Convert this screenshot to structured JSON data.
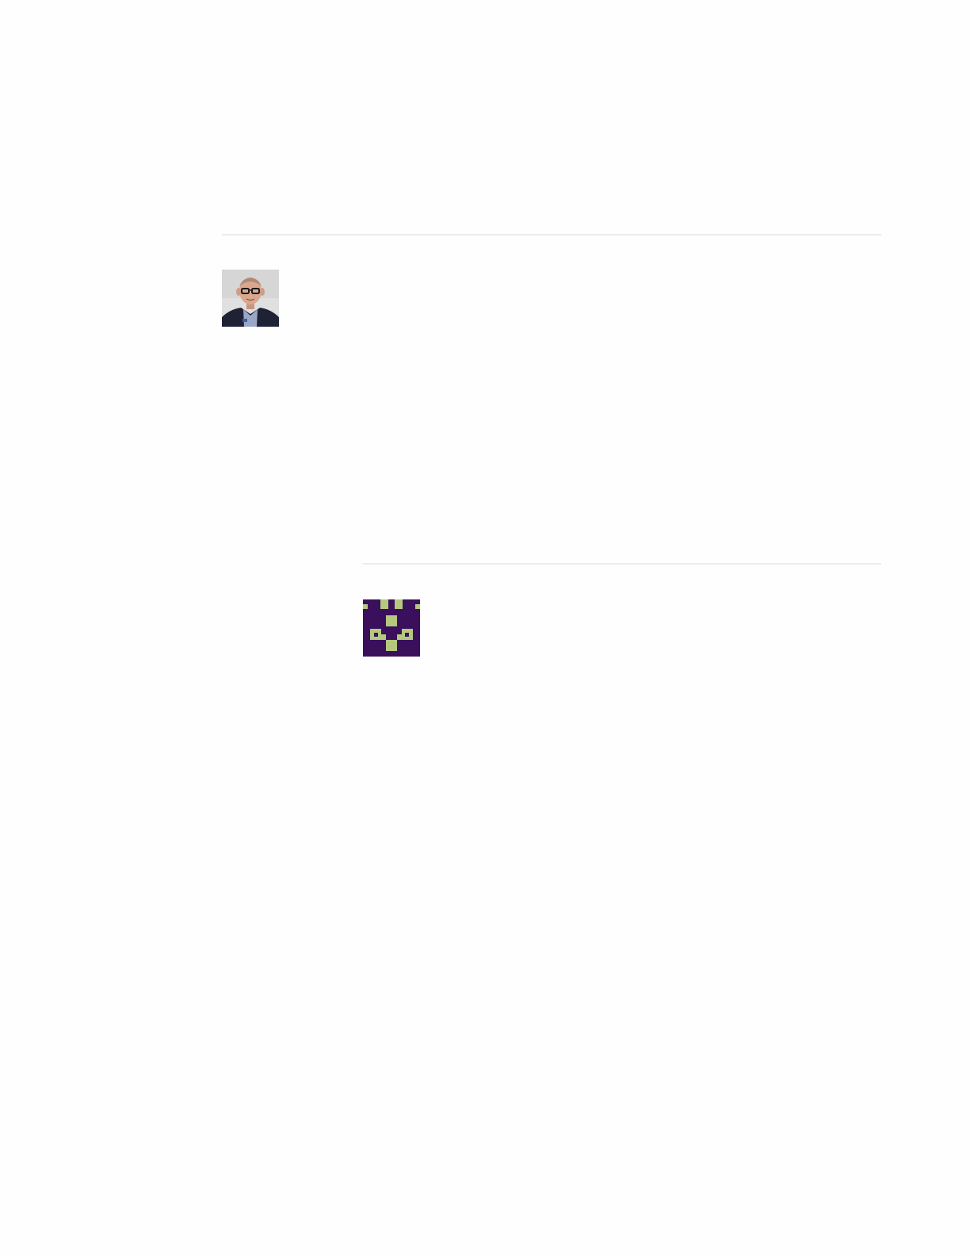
{
  "comments": [
    {
      "avatar": {
        "kind": "photo",
        "icon": "user-photo-icon",
        "colors": {
          "background": "#dcdcdc",
          "skin": "#d9a88f",
          "jacket": "#1f2235",
          "shirt": "#9aa7c6",
          "glasses": "#1a1a1a"
        }
      }
    }
  ],
  "replies": [
    {
      "avatar": {
        "kind": "identicon",
        "icon": "identicon-icon",
        "colors": {
          "background": "#3a0f5c",
          "foreground": "#b5c97d"
        }
      }
    }
  ],
  "colors": {
    "page_background": "#fefefe",
    "divider": "#ececec"
  }
}
